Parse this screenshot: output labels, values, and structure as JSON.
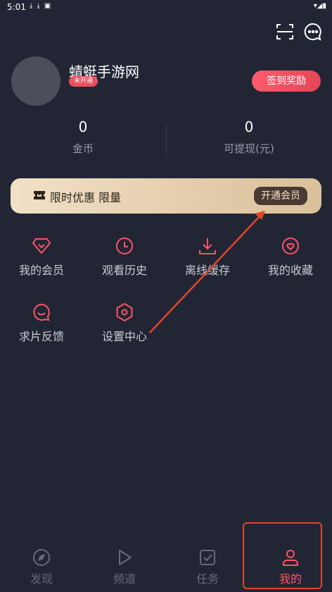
{
  "status_bar": {
    "time": "5:01"
  },
  "profile": {
    "username": "蜻蜓手游网",
    "vip_badge": "未开通",
    "sign_button": "签到奖励"
  },
  "stats": [
    {
      "value": "0",
      "label": "金币"
    },
    {
      "value": "0",
      "label": "可提现(元)"
    }
  ],
  "vip_banner": {
    "text": "限时优惠 限量",
    "button": "开通会员"
  },
  "menu": [
    {
      "label": "我的会员",
      "icon": "diamond-heart-icon"
    },
    {
      "label": "观看历史",
      "icon": "clock-icon"
    },
    {
      "label": "离线缓存",
      "icon": "download-icon"
    },
    {
      "label": "我的收藏",
      "icon": "heart-icon"
    },
    {
      "label": "求片反馈",
      "icon": "chat-bubble-icon"
    },
    {
      "label": "设置中心",
      "icon": "hexagon-settings-icon"
    }
  ],
  "tabs": [
    {
      "label": "发现",
      "icon": "compass-icon"
    },
    {
      "label": "频道",
      "icon": "play-icon"
    },
    {
      "label": "任务",
      "icon": "task-check-icon"
    },
    {
      "label": "我的",
      "icon": "person-icon",
      "active": true
    }
  ],
  "colors": {
    "background": "#222634",
    "accent": "#ff5366",
    "annotation": "#e2452c"
  }
}
